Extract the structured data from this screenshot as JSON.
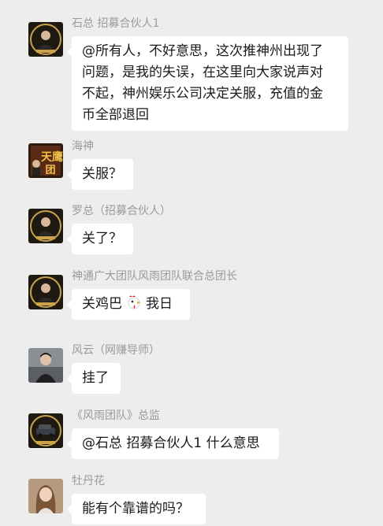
{
  "messages": [
    {
      "sender": "石总 招募合伙人1",
      "avatar": "avatar-man-suit",
      "lines": [
        "@所有人，不好意思，这次推神州出现了",
        "问题，是我的失误，在这里向大家说声对",
        "不起，神州娱乐公司决定关服，充值的金",
        "币全部退回"
      ]
    },
    {
      "sender": "海神",
      "avatar": "avatar-tianying-team-logo",
      "lines": [
        "关服？"
      ]
    },
    {
      "sender": "罗总（招募合伙人）",
      "avatar": "avatar-man-suit",
      "lines": [
        "关了？"
      ]
    },
    {
      "sender": "神通广大团队风雨团队联合总团长",
      "avatar": "avatar-man-suit",
      "text_before": "关鸡巴",
      "emoji": "rooster-icon",
      "text_after": "我日"
    },
    {
      "sender": "风云（网赚导师）",
      "avatar": "avatar-man-photo",
      "lines": [
        "挂了"
      ]
    },
    {
      "sender": "《风雨团队》总监",
      "avatar": "avatar-car-badge",
      "lines": [
        "@石总 招募合伙人1 什么意思"
      ]
    },
    {
      "sender": "牡丹花",
      "avatar": "avatar-woman-photo",
      "lines": [
        "能有个靠谱的吗？"
      ]
    }
  ],
  "colors": {
    "background": "#ededed",
    "bubble": "#ffffff",
    "sender_text": "#9a9a9a",
    "message_text": "#1a1a1a"
  }
}
